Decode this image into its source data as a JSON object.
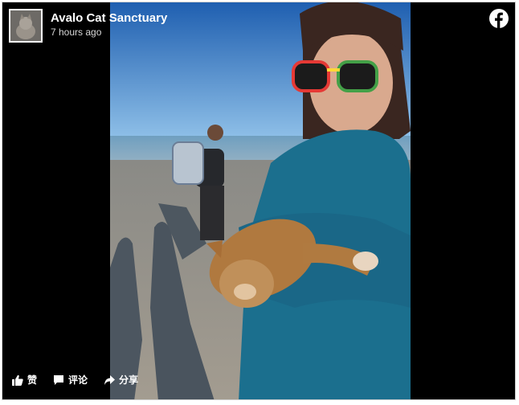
{
  "post": {
    "page_name": "Avalo Cat Sanctuary",
    "timestamp": "7 hours ago"
  },
  "actions": {
    "like_label": "赞",
    "comment_label": "评论",
    "share_label": "分享"
  },
  "icons": {
    "brand": "facebook-icon",
    "like": "thumbs-up-icon",
    "comment": "speech-bubble-icon",
    "share": "share-arrow-icon"
  },
  "colors": {
    "frame_bg": "#000000",
    "text": "#ffffff",
    "subtext": "#d8d8d8"
  }
}
